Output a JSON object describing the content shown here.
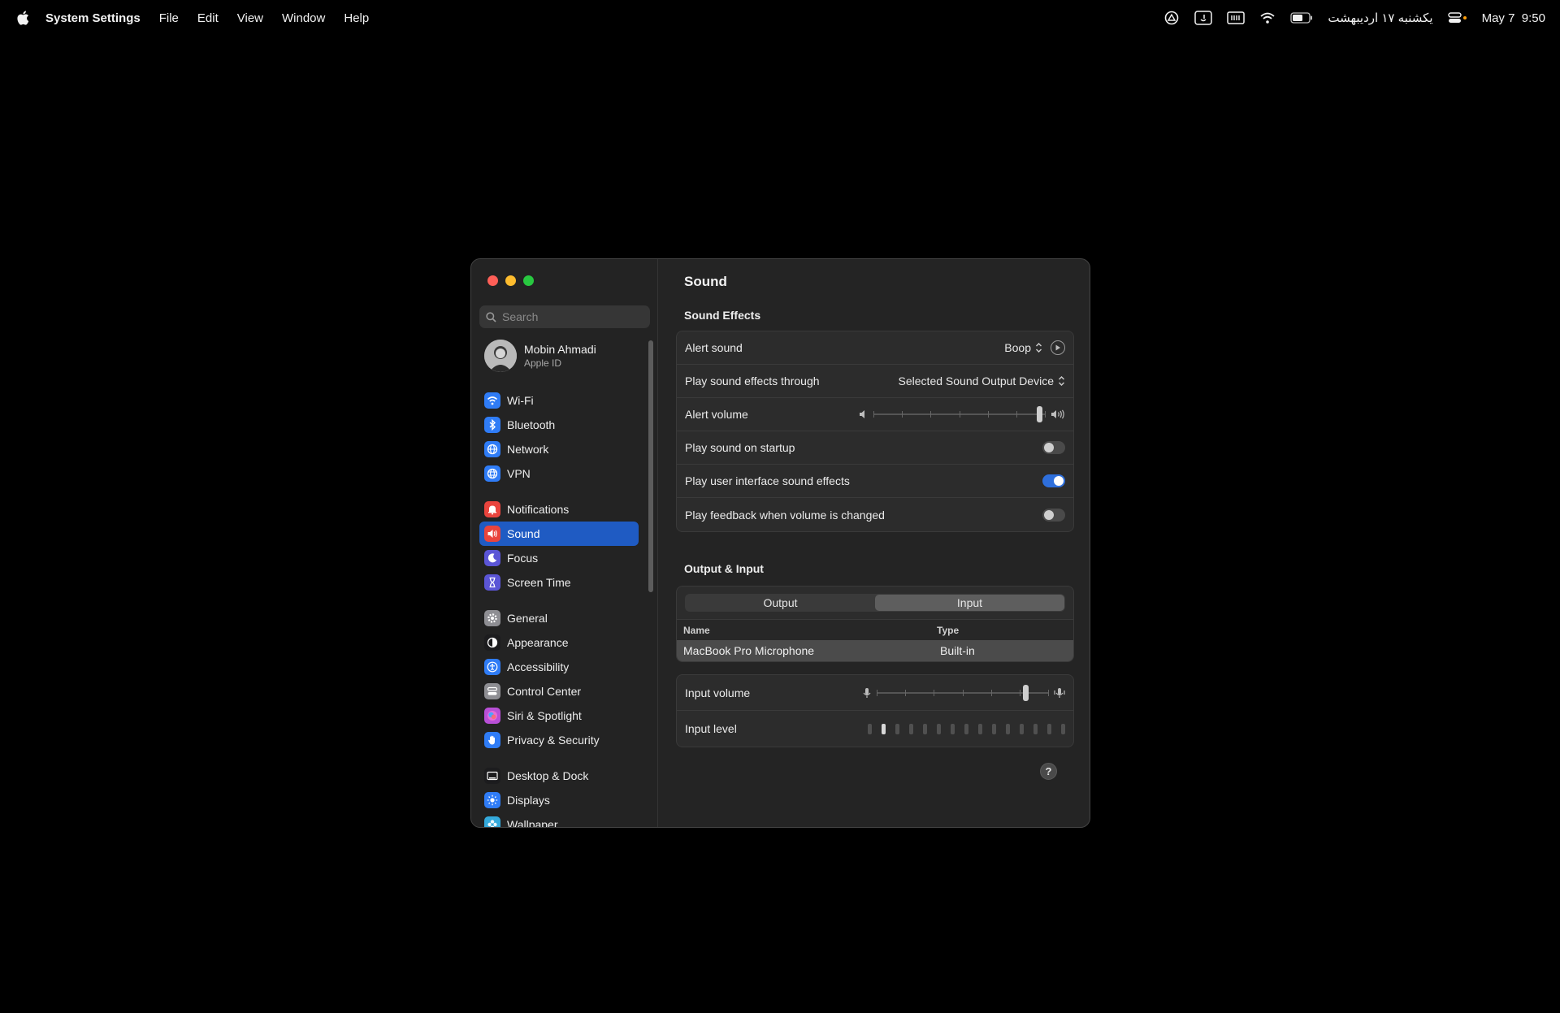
{
  "menubar": {
    "app_name": "System Settings",
    "menus": [
      "File",
      "Edit",
      "View",
      "Window",
      "Help"
    ],
    "status": {
      "calendar_text": "یکشنبه ۱۷ اردیبهشت",
      "date": "May 7",
      "time": "9:50"
    }
  },
  "sidebar": {
    "search_placeholder": "Search",
    "account": {
      "name": "Mobin Ahmadi",
      "subtitle": "Apple ID"
    },
    "groups": [
      [
        {
          "label": "Wi-Fi",
          "icon": "wifi-icon",
          "color": "#2f7cf6"
        },
        {
          "label": "Bluetooth",
          "icon": "bluetooth-icon",
          "color": "#2f7cf6"
        },
        {
          "label": "Network",
          "icon": "globe-icon",
          "color": "#2f7cf6"
        },
        {
          "label": "VPN",
          "icon": "vpn-globe-icon",
          "color": "#2f7cf6"
        }
      ],
      [
        {
          "label": "Notifications",
          "icon": "bell-icon",
          "color": "#e9443d"
        },
        {
          "label": "Sound",
          "icon": "speaker-icon",
          "color": "#e9443d",
          "active": true
        },
        {
          "label": "Focus",
          "icon": "moon-icon",
          "color": "#5b55d6"
        },
        {
          "label": "Screen Time",
          "icon": "hourglass-icon",
          "color": "#5b55d6"
        }
      ],
      [
        {
          "label": "General",
          "icon": "gear-icon",
          "color": "#8e8e93"
        },
        {
          "label": "Appearance",
          "icon": "appearance-icon",
          "color": "#1c1c1e"
        },
        {
          "label": "Accessibility",
          "icon": "accessibility-icon",
          "color": "#2f7cf6"
        },
        {
          "label": "Control Center",
          "icon": "control-center-icon",
          "color": "#8e8e93"
        },
        {
          "label": "Siri & Spotlight",
          "icon": "siri-icon",
          "color": "#b84fd6"
        },
        {
          "label": "Privacy & Security",
          "icon": "hand-icon",
          "color": "#2f7cf6"
        }
      ],
      [
        {
          "label": "Desktop & Dock",
          "icon": "dock-icon",
          "color": "#1c1c1e"
        },
        {
          "label": "Displays",
          "icon": "sun-icon",
          "color": "#2f7cf6"
        },
        {
          "label": "Wallpaper",
          "icon": "flower-icon",
          "color": "#34aadc"
        }
      ]
    ]
  },
  "main": {
    "title": "Sound",
    "sound_effects": {
      "title": "Sound Effects",
      "alert_sound_label": "Alert sound",
      "alert_sound_value": "Boop",
      "play_through_label": "Play sound effects through",
      "play_through_value": "Selected Sound Output Device",
      "alert_volume_label": "Alert volume",
      "alert_volume_level": 0.98,
      "startup_label": "Play sound on startup",
      "startup_on": false,
      "ui_sounds_label": "Play user interface sound effects",
      "ui_sounds_on": true,
      "feedback_label": "Play feedback when volume is changed",
      "feedback_on": false
    },
    "output_input": {
      "title": "Output & Input",
      "tabs": [
        "Output",
        "Input"
      ],
      "active_tab": "Input",
      "columns": [
        "Name",
        "Type"
      ],
      "devices": [
        {
          "name": "MacBook Pro Microphone",
          "type": "Built-in"
        }
      ],
      "input_volume_label": "Input volume",
      "input_volume_level": 0.88,
      "input_level_label": "Input level",
      "input_level_bars": 15,
      "input_level_lit": 1
    }
  },
  "colors": {
    "accent": "#1f5bc3",
    "toggle_on": "#2e6fdc",
    "window_bg": "#242424"
  }
}
